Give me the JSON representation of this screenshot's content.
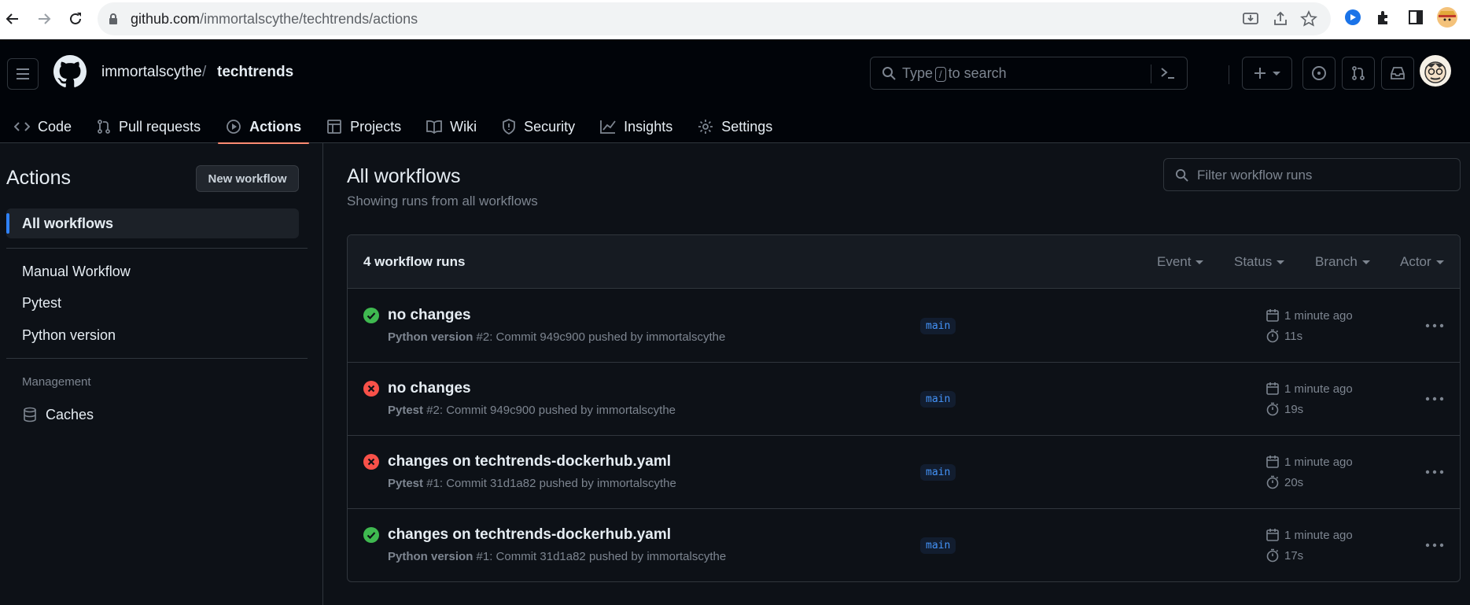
{
  "browser": {
    "url_host": "github.com",
    "url_path": "/immortalscythe/techtrends/actions"
  },
  "header": {
    "owner": "immortalscythe",
    "separator": "/",
    "repo": "techtrends",
    "search_prefix": "Type",
    "search_key": "/",
    "search_suffix": "to search"
  },
  "tabs": [
    {
      "label": "Code",
      "icon": "code-icon"
    },
    {
      "label": "Pull requests",
      "icon": "pull-request-icon"
    },
    {
      "label": "Actions",
      "icon": "play-icon",
      "active": true
    },
    {
      "label": "Projects",
      "icon": "table-icon"
    },
    {
      "label": "Wiki",
      "icon": "book-icon"
    },
    {
      "label": "Security",
      "icon": "shield-icon"
    },
    {
      "label": "Insights",
      "icon": "graph-icon"
    },
    {
      "label": "Settings",
      "icon": "gear-icon"
    }
  ],
  "sidebar": {
    "title": "Actions",
    "new_workflow": "New workflow",
    "all_workflows": "All workflows",
    "workflows": [
      "Manual Workflow",
      "Pytest",
      "Python version"
    ],
    "management_label": "Management",
    "caches": "Caches"
  },
  "main": {
    "title": "All workflows",
    "subtitle": "Showing runs from all workflows",
    "filter_placeholder": "Filter workflow runs",
    "runs_count": "4 workflow runs",
    "filters": [
      "Event",
      "Status",
      "Branch",
      "Actor"
    ],
    "runs": [
      {
        "status": "success",
        "title": "no changes",
        "workflow": "Python version",
        "meta": " #2: Commit 949c900 pushed by immortalscythe",
        "branch": "main",
        "when": "1 minute ago",
        "duration": "11s"
      },
      {
        "status": "failure",
        "title": "no changes",
        "workflow": "Pytest",
        "meta": " #2: Commit 949c900 pushed by immortalscythe",
        "branch": "main",
        "when": "1 minute ago",
        "duration": "19s"
      },
      {
        "status": "failure",
        "title": "changes on techtrends-dockerhub.yaml",
        "workflow": "Pytest",
        "meta": " #1: Commit 31d1a82 pushed by immortalscythe",
        "branch": "main",
        "when": "1 minute ago",
        "duration": "20s"
      },
      {
        "status": "success",
        "title": "changes on techtrends-dockerhub.yaml",
        "workflow": "Python version",
        "meta": " #1: Commit 31d1a82 pushed by immortalscythe",
        "branch": "main",
        "when": "1 minute ago",
        "duration": "17s"
      }
    ]
  },
  "colors": {
    "success": "#3fb950",
    "failure": "#f85149",
    "accent_tab": "#fd8c73",
    "branch_text": "#4493f8"
  }
}
